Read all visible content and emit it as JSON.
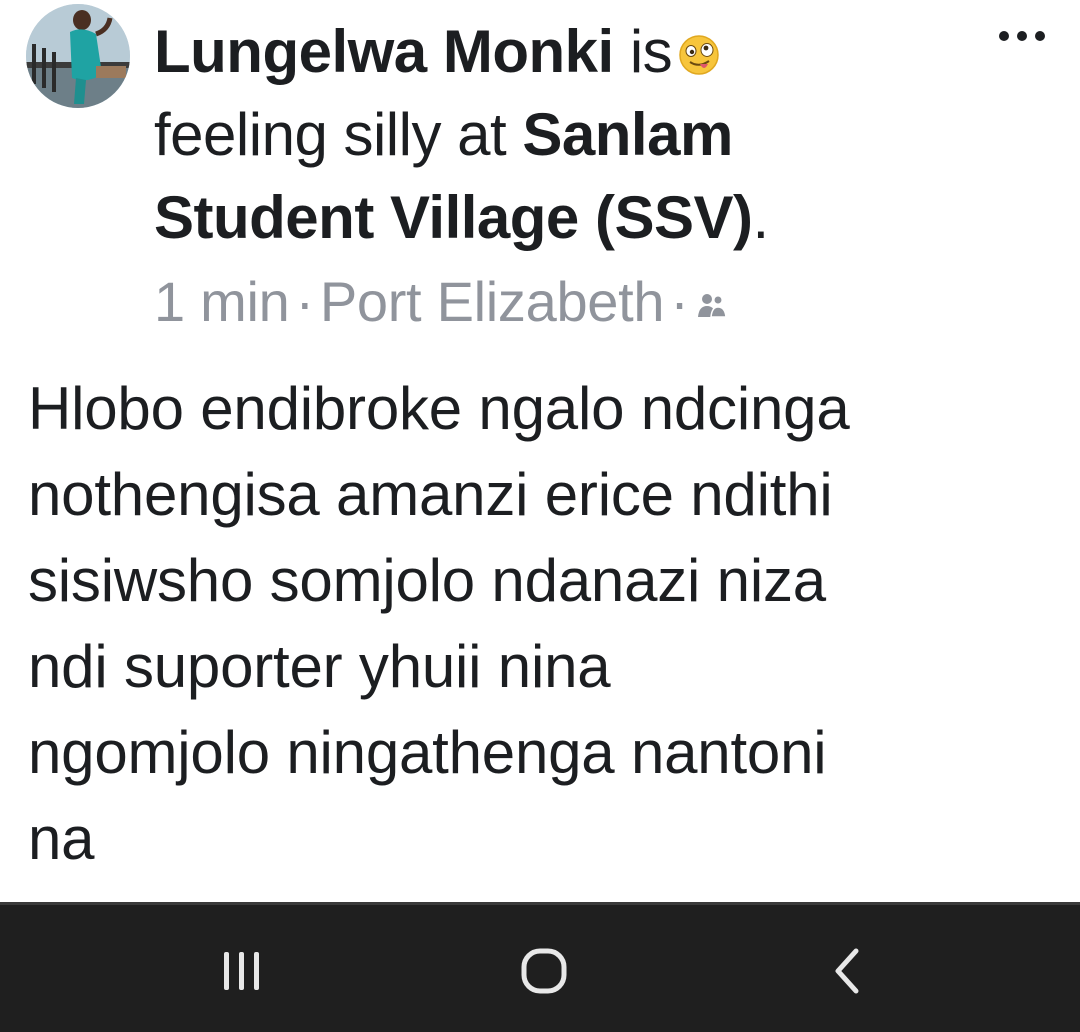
{
  "post": {
    "author_name": "Lungelwa Monki",
    "activity_prefix": " is",
    "activity_emoji": "silly-face-emoji",
    "activity_feeling": "feeling silly at ",
    "location_name_line1": "Sanlam",
    "location_name_line2": "Student Village (SSV)",
    "location_period": ".",
    "time": "1 min",
    "separator": "·",
    "place": "Port Elizabeth",
    "privacy_icon": "friends-icon",
    "more_icon": "more-options-icon",
    "body_lines": [
      "Hlobo endibroke ngalo ndcinga",
      "nothengisa amanzi erice ndithi",
      "sisiwsho somjolo ndanazi niza",
      "ndi suporter yhuii nina",
      "ngomjolo ningathenga nantoni",
      "na"
    ]
  },
  "nav_bar": {
    "recent_apps_icon": "recent-apps-icon",
    "home_icon": "home-icon",
    "back_icon": "back-icon",
    "background": "#1f1f1f"
  },
  "colors": {
    "text_primary": "#1c1e21",
    "text_meta": "#90949c",
    "emoji_yellow": "#f7c53c"
  }
}
